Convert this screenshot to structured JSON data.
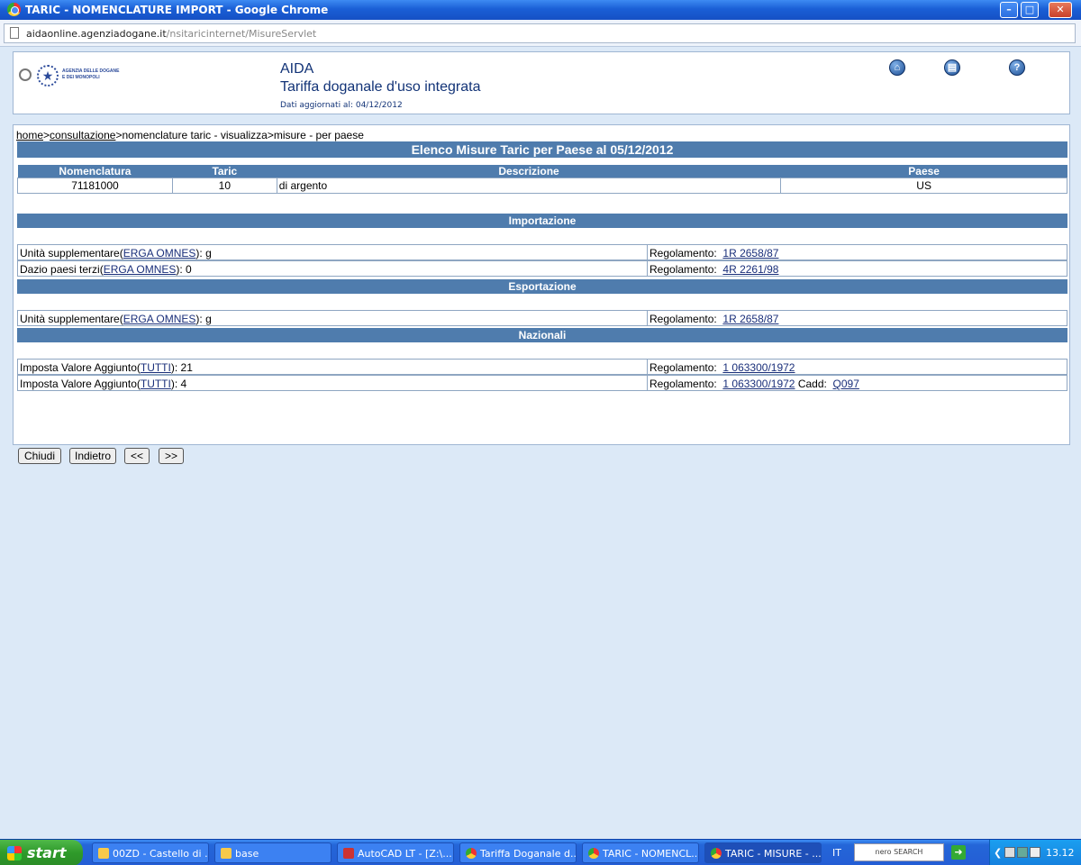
{
  "window": {
    "title": "TARIC - NOMENCLATURE IMPORT - Google Chrome",
    "url_host": "aidaonline.agenziadogane.it",
    "url_path": "/nsitaricinternet/MisureServlet"
  },
  "header": {
    "agency_line1": "AGENZIA DELLE DOGANE",
    "agency_line2": "E DEI MONOPOLI",
    "app": "AIDA",
    "subtitle": "Tariffa doganale d'uso integrata",
    "updated": "Dati aggiornati al: 04/12/2012"
  },
  "breadcrumb": {
    "home": "home",
    "sep1": ">",
    "consultazione": "consultazione",
    "rest": ">nomenclature taric - visualizza>misure - per paese"
  },
  "main_title": "Elenco Misure Taric per Paese al 05/12/2012",
  "summary": {
    "headers": [
      "Nomenclatura",
      "Taric",
      "Descrizione",
      "Paese"
    ],
    "row": [
      "71181000",
      "10",
      "di argento",
      "US"
    ]
  },
  "sections": {
    "import": "Importazione",
    "export": "Esportazione",
    "national": "Nazionali"
  },
  "measures": {
    "import": [
      {
        "prefix": "Unità supplementare(",
        "link": "ERGA OMNES",
        "suffix": "): g",
        "reg_label": "Regolamento:",
        "reg": "1R 2658/87"
      },
      {
        "prefix": "Dazio paesi terzi(",
        "link": "ERGA OMNES",
        "suffix": "): 0",
        "reg_label": "Regolamento:",
        "reg": "4R 2261/98"
      }
    ],
    "export": [
      {
        "prefix": "Unità supplementare(",
        "link": "ERGA OMNES",
        "suffix": "): g",
        "reg_label": "Regolamento:",
        "reg": "1R 2658/87"
      }
    ],
    "national": [
      {
        "prefix": "Imposta Valore Aggiunto(",
        "link": "TUTTI",
        "suffix": "):  21",
        "reg_label": "Regolamento:",
        "reg": "1 063300/1972"
      },
      {
        "prefix": "Imposta Valore Aggiunto(",
        "link": "TUTTI",
        "suffix": "):  4",
        "reg_label": "Regolamento:",
        "reg": "1 063300/1972",
        "cadd_label": "Cadd:",
        "cadd": "Q097"
      }
    ]
  },
  "buttons": {
    "close": "Chiudi",
    "back": "Indietro",
    "prev": "<<",
    "next": ">>"
  },
  "taskbar": {
    "start": "start",
    "items": [
      "00ZD - Castello di ...",
      "base",
      "AutoCAD LT - [Z:\\...",
      "Tariffa Doganale d...",
      "TARIC - NOMENCL...",
      "TARIC - MISURE - ..."
    ],
    "lang": "IT",
    "search": "nero SEARCH",
    "clock": "13.12"
  },
  "colors": {
    "band": "#4f7cad",
    "page_bg": "#dce9f7",
    "link": "#1a2f7a"
  }
}
